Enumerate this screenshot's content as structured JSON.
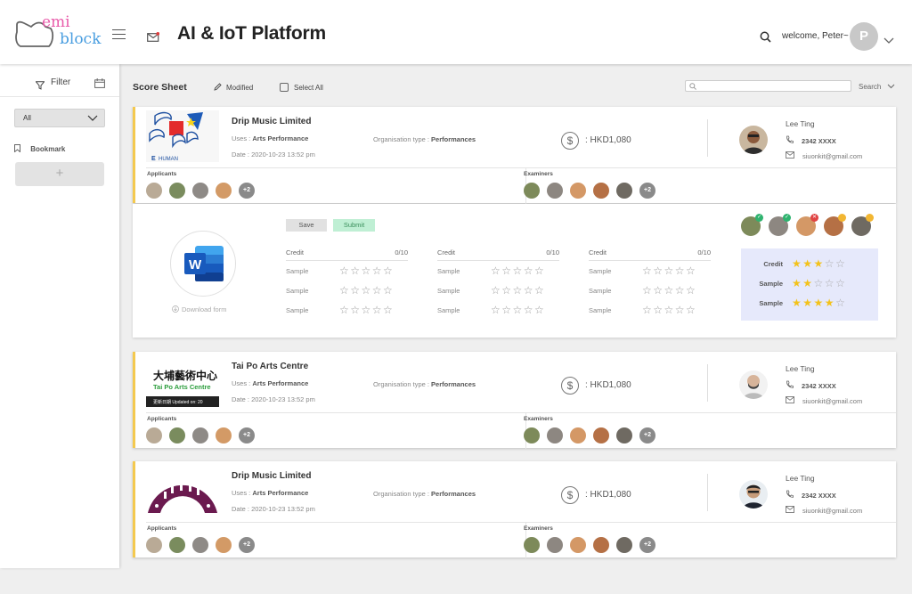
{
  "app": {
    "title": "AI & IoT Platform",
    "logo_line1": "emi",
    "logo_line2": "block",
    "welcome": "welcome, Peter~",
    "avatar_initial": "P"
  },
  "sidebar": {
    "filter_label": "Filter",
    "select_value": "All",
    "bookmark_label": "Bookmark",
    "add_label": "+"
  },
  "header": {
    "title": "Score Sheet",
    "modified_label": "Modified",
    "select_all_label": "Select All",
    "search_label": "Search"
  },
  "cards": [
    {
      "org": "Drip Music Limited",
      "uses_label": "Uses :",
      "uses": "Arts Performance",
      "date": "Date : 2020-10-23 13:52 pm",
      "orgtype_label": "Organisation type :",
      "orgtype": "Performances",
      "amount": ": HKD1,080",
      "contact_name": "Lee Ting",
      "contact_phone": "2342 XXXX",
      "contact_email": "siuonkit@gmail.com",
      "applicants_label": "Applicants",
      "examiners_label": "Examiners",
      "more_applicants": "+2",
      "more_examiners": "+2"
    },
    {
      "org": "Tai Po Arts Centre",
      "uses_label": "Uses :",
      "uses": "Arts Performance",
      "date": "Date : 2020-10-23 13:52 pm",
      "orgtype_label": "Organisation type :",
      "orgtype": "Performances",
      "amount": ": HKD1,080",
      "contact_name": "Lee Ting",
      "contact_phone": "2342 XXXX",
      "contact_email": "siuonkit@gmail.com",
      "applicants_label": "Applicants",
      "examiners_label": "Examiners",
      "more_applicants": "+2",
      "more_examiners": "+2",
      "thumb_cn": "大埔藝術中心",
      "thumb_en": "Tai Po Arts Centre",
      "thumb_update": "更新日期 Updated on: 20"
    },
    {
      "org": "Drip Music Limited",
      "uses_label": "Uses :",
      "uses": "Arts Performance",
      "date": "Date : 2020-10-23 13:52 pm",
      "orgtype_label": "Organisation type :",
      "orgtype": "Performances",
      "amount": ": HKD1,080",
      "contact_name": "Lee Ting",
      "contact_phone": "2342 XXXX",
      "contact_email": "siuonkit@gmail.com",
      "applicants_label": "Applicants",
      "examiners_label": "Examiners",
      "more_applicants": "+2",
      "more_examiners": "+2"
    }
  ],
  "card1_thumb_text": "HUMAN",
  "score_form": {
    "save_label": "Save",
    "submit_label": "Submit",
    "download_label": "Download form",
    "word_letter": "W",
    "columns": [
      {
        "head": "Credit",
        "score": "0/10",
        "rows": [
          "Sample",
          "Sample",
          "Sample"
        ]
      },
      {
        "head": "Credit",
        "score": "0/10",
        "rows": [
          "Sample",
          "Sample",
          "Sample"
        ]
      },
      {
        "head": "Credit",
        "score": "0/10",
        "rows": [
          "Sample",
          "Sample",
          "Sample"
        ]
      }
    ],
    "empty_stars": "☆☆☆☆☆",
    "summary": [
      {
        "label": "Credit",
        "rating": 3
      },
      {
        "label": "Sample",
        "rating": 2
      },
      {
        "label": "Sample",
        "rating": 4
      }
    ]
  },
  "colors": {
    "accent_bar": "#f4c94f",
    "submit_bg": "#bfefd4",
    "summary_bg": "#e6e9fb",
    "star_on": "#f3c21a",
    "check_green": "#2fb36f",
    "reject_red": "#e04343",
    "pending_orange": "#f2b632"
  }
}
